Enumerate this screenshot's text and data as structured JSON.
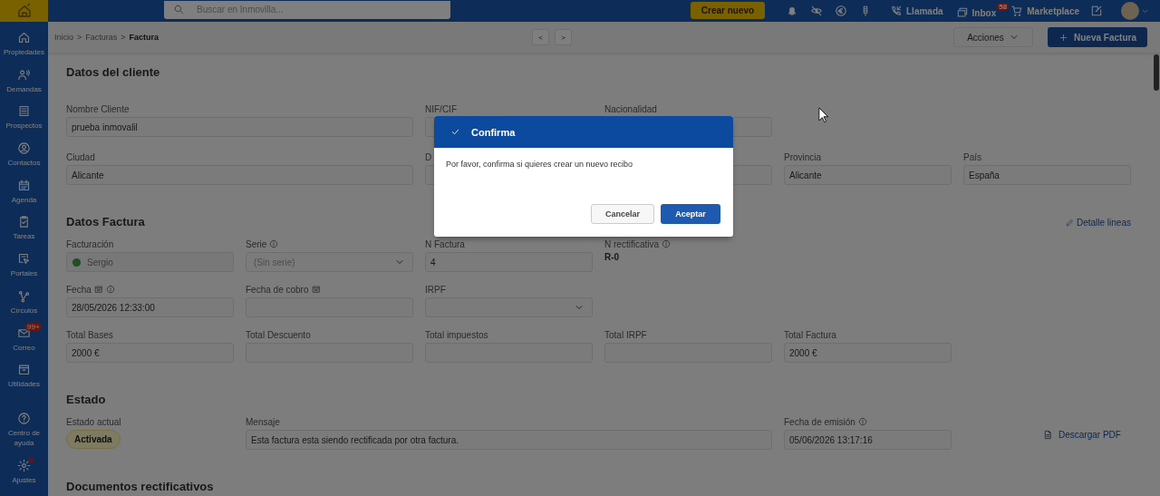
{
  "topbar": {
    "search": {
      "placeholder": "Buscar en Inmovilla..."
    },
    "create_button": "Crear nuevo",
    "links": [
      {
        "label": "Llamada"
      },
      {
        "label": "Inbox",
        "badge": "58"
      },
      {
        "label": "Marketplace"
      }
    ]
  },
  "sidebar": {
    "items": [
      {
        "label": "Propiedades"
      },
      {
        "label": "Demandas"
      },
      {
        "label": "Prospectos"
      },
      {
        "label": "Contactos"
      },
      {
        "label": "Agenda"
      },
      {
        "label": "Tareas"
      },
      {
        "label": "Portales"
      },
      {
        "label": "Círculos"
      },
      {
        "label": "Correo",
        "badge": "99+"
      },
      {
        "label": "Utilidades"
      }
    ],
    "bottom_items": [
      {
        "label": "Centro de ayuda",
        "alert": false
      },
      {
        "label": "Ajustes",
        "alert": true
      }
    ]
  },
  "breadcrumb": [
    {
      "label": "Inicio",
      "current": false
    },
    {
      "label": "Facturas",
      "current": false,
      "separator": ">"
    },
    {
      "label": "Factura",
      "current": true,
      "separator": ">"
    }
  ],
  "nav_buttons": [
    "<",
    ">"
  ],
  "actions": "Acciones",
  "new_button": "Nueva Factura",
  "sections": [
    {
      "title": "Datos del cliente",
      "fields": [
        {
          "kind": "input",
          "label": "Nombre Cliente",
          "value": "prueba inmovalil"
        },
        {
          "kind": "input",
          "label": "NIF/CIF"
        },
        {
          "kind": "input",
          "label": "Nacionalidad"
        },
        {
          "kind": "input",
          "label": "Ciudad",
          "value": "Alicante"
        },
        {
          "kind": "input",
          "label": "D"
        },
        {
          "kind": "input"
        },
        {
          "kind": "input",
          "label": "Provincia",
          "value": "Alicante"
        },
        {
          "kind": "input",
          "label": "País",
          "value": "España"
        }
      ]
    },
    {
      "title": "Datos Factura",
      "link": "Detalle lineas",
      "fields": [
        {
          "kind": "input",
          "label": "Facturación",
          "value": "Sergio",
          "disabled": true
        },
        {
          "kind": "select",
          "label": "Serie",
          "placeholder": "(Sin serie)"
        },
        {
          "kind": "input",
          "label": "N Factura",
          "value": "4"
        },
        {
          "kind": "text",
          "label": "N rectificativa",
          "value": "R-0"
        },
        {
          "kind": "input",
          "label": "Fecha",
          "value": "28/05/2026 12:33:00"
        },
        {
          "kind": "input",
          "label": "Fecha de cobro"
        },
        {
          "kind": "select",
          "label": "IRPF"
        },
        {
          "kind": "input",
          "label": "Total Bases",
          "value": "2000 €"
        },
        {
          "kind": "input",
          "label": "Total Descuento"
        },
        {
          "kind": "input",
          "label": "Total impuestos"
        },
        {
          "kind": "input",
          "label": "Total IRPF"
        },
        {
          "kind": "input",
          "label": "Total Factura",
          "value": "2000 €"
        }
      ]
    },
    {
      "title": "Estado",
      "fields": [
        {
          "kind": "badge",
          "label": "Estado actual",
          "value": "Activada"
        },
        {
          "kind": "input",
          "label": "Mensaje",
          "value": "Esta factura esta siendo rectificada por otra factura."
        },
        {
          "kind": "input",
          "label": "Fecha de emisión",
          "value": "05/06/2026 13:17:16"
        },
        {
          "kind": "link",
          "value": "Descargar PDF"
        }
      ]
    },
    {
      "title": "Documentos rectificativos"
    }
  ],
  "dialog": {
    "title": "Confirma",
    "message": "Por favor, confirma si quieres crear un nuevo recibo",
    "buttons": [
      {
        "label": "Cancelar",
        "kind": "secondary"
      },
      {
        "label": "Aceptar",
        "kind": "primary"
      }
    ]
  }
}
